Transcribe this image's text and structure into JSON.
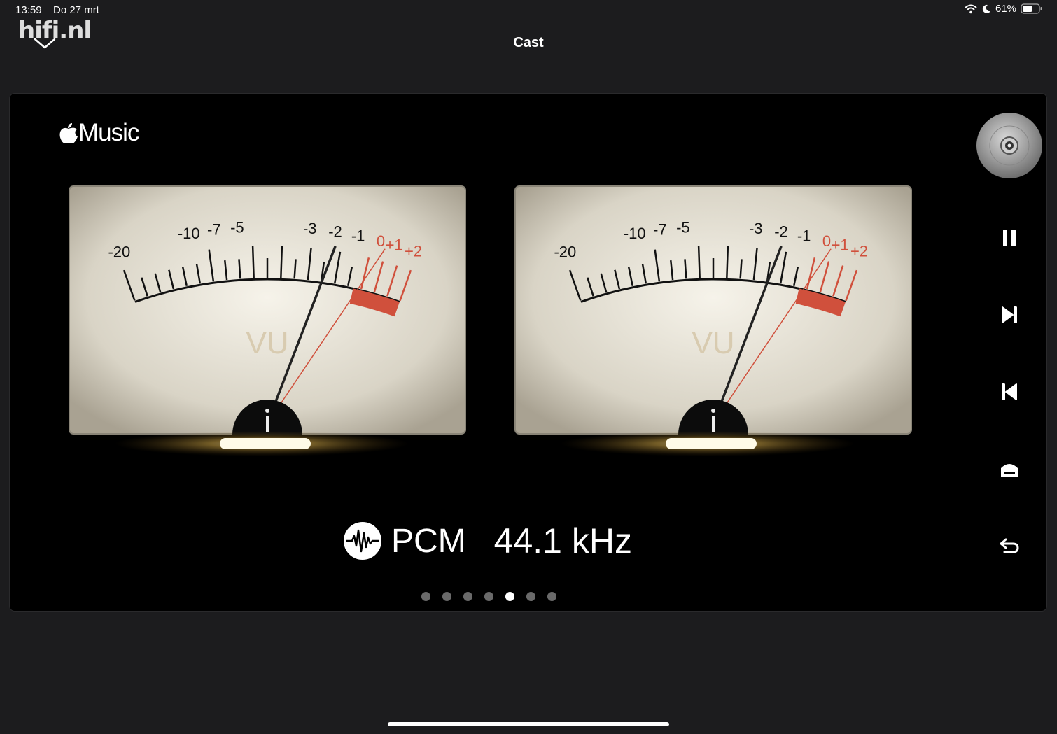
{
  "status_bar": {
    "time": "13:59",
    "date": "Do 27 mrt",
    "battery": "61%",
    "battery_level": 0.61
  },
  "watermark": "hifi.nl",
  "header": {
    "title": "Cast"
  },
  "player": {
    "service": "Music",
    "meters": [
      {
        "channel": "left",
        "label": "VU",
        "scale": [
          "-20",
          "-10",
          "-7",
          "-5",
          "-3",
          "-2",
          "-1",
          "0",
          "+1",
          "+2"
        ]
      },
      {
        "channel": "right",
        "label": "VU",
        "scale": [
          "-20",
          "-10",
          "-7",
          "-5",
          "-3",
          "-2",
          "-1",
          "0",
          "+1",
          "+2"
        ]
      }
    ],
    "format": "PCM",
    "sample_rate": "44.1 kHz",
    "pages": {
      "count": 7,
      "active": 5
    }
  },
  "colors": {
    "background": "#1c1c1e",
    "panel": "#000000",
    "meter_face": "#e4e0d4",
    "red_zone": "#d0503c",
    "glow": "#f0c050"
  }
}
